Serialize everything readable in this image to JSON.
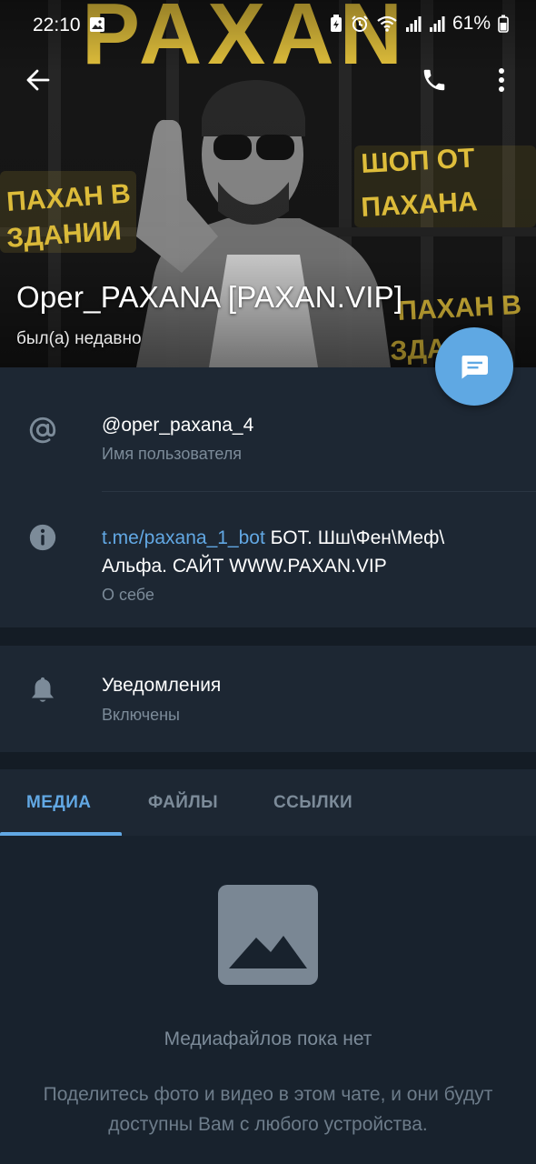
{
  "status_bar": {
    "time": "22:10",
    "battery": "61%"
  },
  "header": {
    "profile_name": "Oper_PAXANA [PAXAN.VIP]",
    "last_seen": "был(а) недавно",
    "banner": {
      "logo_text": "PAXAN",
      "left_text_1": "ПАХАН В",
      "left_text_2": "ЗДАНИИ",
      "right_text_1": "ШОП ОТ",
      "right_text_2": "ПАХАНА",
      "right_text_3": "ПАХАН В",
      "right_text_4": "ЗДАН"
    }
  },
  "info": {
    "username": "@oper_paxana_4",
    "username_caption": "Имя пользователя",
    "bio_link": "t.me/paxana_1_bot",
    "bio_text_1": " БОТ. Шш\\Фен\\Меф\\",
    "bio_text_2": "Альфа. САЙТ WWW.PAXAN.VIP",
    "bio_caption": "О себе"
  },
  "notifications": {
    "title": "Уведомления",
    "state": "Включены"
  },
  "tabs": [
    {
      "label": "МЕДИА",
      "active": true
    },
    {
      "label": "ФАЙЛЫ",
      "active": false
    },
    {
      "label": "ССЫЛКИ",
      "active": false
    }
  ],
  "empty_state": {
    "title": "Медиафайлов пока нет",
    "description_line_1": "Поделитесь фото и видео в этом чате, и они будут",
    "description_line_2": "доступны Вам с любого устройства."
  },
  "icons": {
    "back": "arrow-left-icon",
    "call": "phone-icon",
    "more": "more-vertical-icon",
    "message": "message-icon",
    "username": "at-sign-icon",
    "bio": "info-icon",
    "notifications": "bell-icon",
    "empty_media": "image-placeholder-icon"
  },
  "colors": {
    "accent": "#62a8e4",
    "fab": "#5fa8e3",
    "background": "#18222d",
    "card": "#1d2733",
    "banner_yellow": "#e4c23c"
  }
}
